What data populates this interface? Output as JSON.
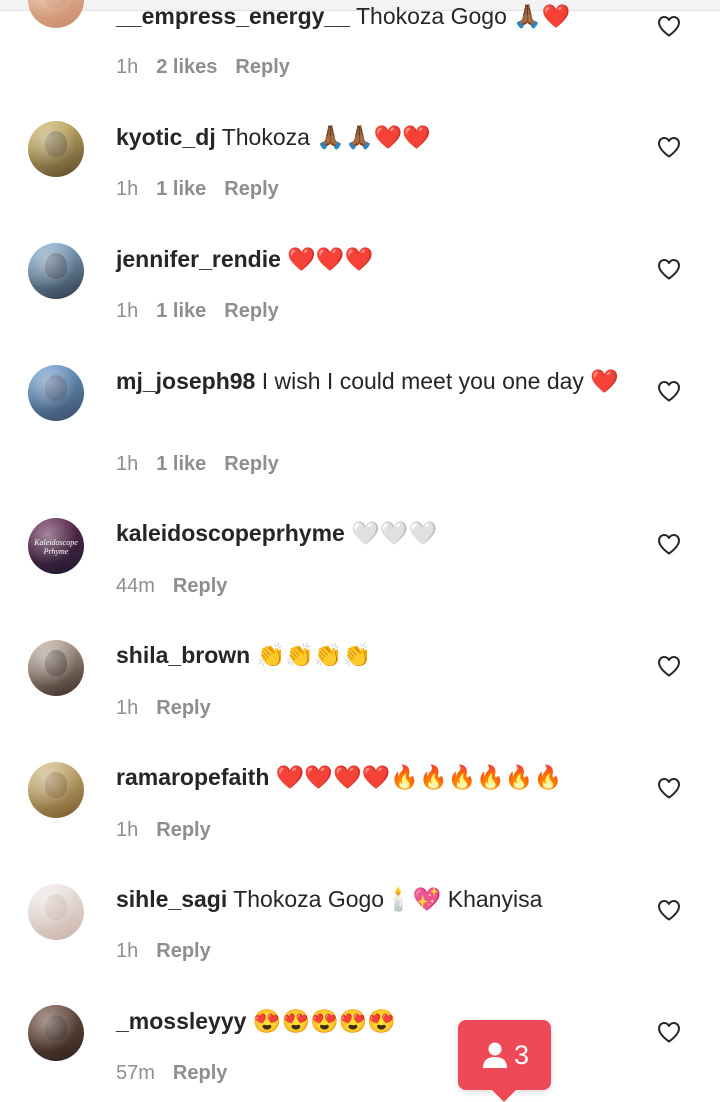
{
  "comments": [
    {
      "username": "__empress_energy__",
      "text": "Thokoza Gogo 🙏🏾❤️",
      "time": "1h",
      "likes": "2 likes",
      "reply": "Reply",
      "avatar_colors": [
        "#e9b89a",
        "#c98e6e"
      ]
    },
    {
      "username": "kyotic_dj",
      "text": "Thokoza 🙏🏾🙏🏾❤️❤️",
      "time": "1h",
      "likes": "1 like",
      "reply": "Reply",
      "avatar_colors": [
        "#d8c06a",
        "#5b4a2e"
      ]
    },
    {
      "username": "jennifer_rendie",
      "text": "❤️❤️❤️",
      "time": "1h",
      "likes": "1 like",
      "reply": "Reply",
      "avatar_colors": [
        "#8fb7d9",
        "#2f3b4a"
      ]
    },
    {
      "username": "mj_joseph98",
      "text": "I wish I could meet you one day ❤️",
      "time": "1h",
      "likes": "1 like",
      "reply": "Reply",
      "avatar_colors": [
        "#6fa3d6",
        "#3c4d66"
      ]
    },
    {
      "username": "kaleidoscopeprhyme",
      "text": "🤍🤍🤍",
      "time": "44m",
      "likes": "",
      "reply": "Reply",
      "avatar_colors": [
        "#6b2a55",
        "#1e1a2e"
      ],
      "avatar_text": "Kaleidoscope Prhyme"
    },
    {
      "username": "shila_brown",
      "text": "👏👏👏👏",
      "time": "1h",
      "likes": "",
      "reply": "Reply",
      "avatar_colors": [
        "#c9b8a8",
        "#3a2a25"
      ]
    },
    {
      "username": "ramaropefaith",
      "text": "❤️❤️❤️❤️🔥🔥🔥🔥🔥🔥",
      "time": "1h",
      "likes": "",
      "reply": "Reply",
      "avatar_colors": [
        "#d7c48a",
        "#7a5a2a"
      ]
    },
    {
      "username": "sihle_sagi",
      "text": "Thokoza Gogo🕯️💖 Khanyisa",
      "time": "1h",
      "likes": "",
      "reply": "Reply",
      "avatar_colors": [
        "#f2eeee",
        "#c9b3a8"
      ]
    },
    {
      "username": "_mossleyyy",
      "text": "😍😍😍😍😍",
      "time": "57m",
      "likes": "",
      "reply": "Reply",
      "avatar_colors": [
        "#7a5a4a",
        "#2e211b"
      ]
    }
  ],
  "badge": {
    "count": "3",
    "icon": "person-icon",
    "color": "#ee4956"
  },
  "heart_icon": "heart-outline-icon"
}
